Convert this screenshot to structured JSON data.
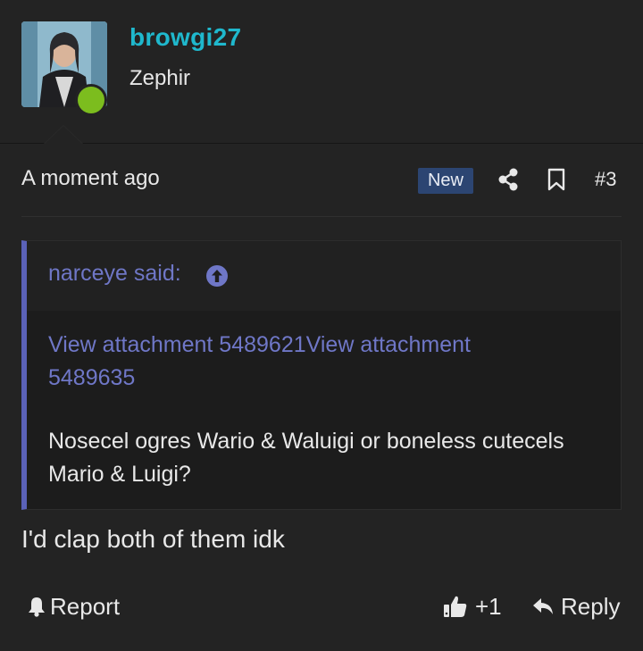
{
  "user": {
    "username": "browgi27",
    "title": "Zephir",
    "online": true
  },
  "meta": {
    "timestamp": "A moment ago",
    "badge": "New",
    "post_number": "#3"
  },
  "quote": {
    "author": "narceye said:",
    "attachments": "View attachment 5489621View attachment 5489635",
    "text": "Nosecel ogres Wario & Waluigi or boneless cutecels Mario & Luigi?"
  },
  "message": "I'd clap both of them idk",
  "actions": {
    "report_label": "Report",
    "like_count": "+1",
    "reply_label": "Reply"
  },
  "icons": {
    "share": "share-icon",
    "bookmark": "bookmark-icon",
    "goto": "arrow-up-circle-icon",
    "report": "bell-icon",
    "like": "thumbs-up-icon",
    "reply": "reply-arrow-icon"
  },
  "colors": {
    "background": "#232323",
    "username": "#1fb8cd",
    "link": "#6f77c7",
    "quote_border": "#5b62b8",
    "badge_bg": "#2c4572",
    "online": "#7cbd1e"
  }
}
